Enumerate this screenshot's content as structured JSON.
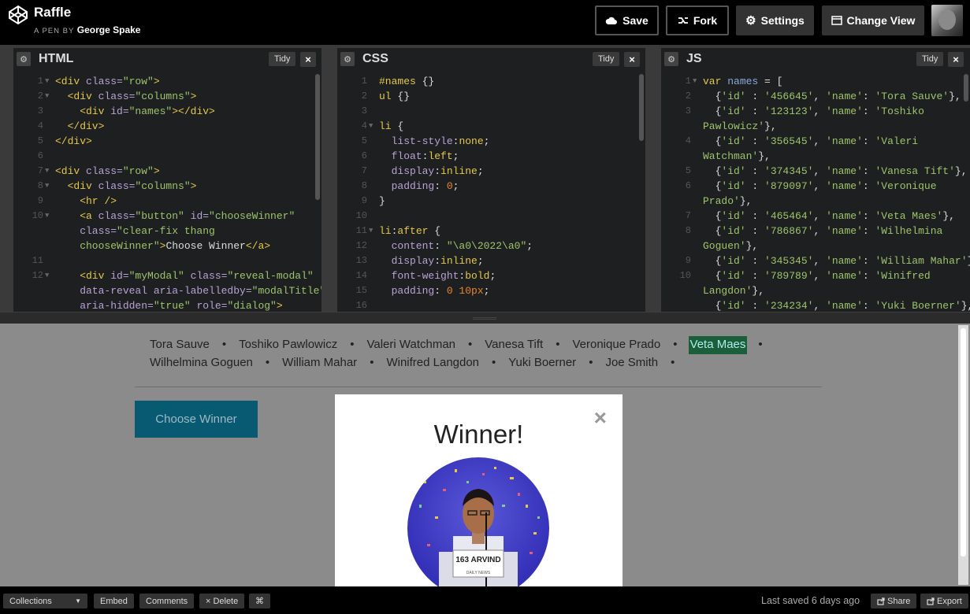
{
  "header": {
    "title": "Raffle",
    "byline_prefix": "A PEN BY",
    "author": "George Spake",
    "buttons": {
      "save": "Save",
      "fork": "Fork",
      "settings": "Settings",
      "change_view": "Change View"
    }
  },
  "editors": {
    "html": {
      "name": "HTML",
      "tidy": "Tidy",
      "close": "×",
      "lines": [
        {
          "n": "1",
          "fold": true,
          "parts": [
            [
              "tag",
              "<div "
            ],
            [
              "attr",
              "class="
            ],
            [
              "str",
              "\"row\""
            ],
            [
              "tag",
              ">"
            ]
          ]
        },
        {
          "n": "2",
          "fold": true,
          "parts": [
            [
              "tag",
              "  <div "
            ],
            [
              "attr",
              "class="
            ],
            [
              "str",
              "\"columns\""
            ],
            [
              "tag",
              ">"
            ]
          ]
        },
        {
          "n": "3",
          "fold": false,
          "parts": [
            [
              "tag",
              "    <div "
            ],
            [
              "attr",
              "id="
            ],
            [
              "str",
              "\"names\""
            ],
            [
              "tag",
              "></div>"
            ]
          ]
        },
        {
          "n": "4",
          "fold": false,
          "parts": [
            [
              "tag",
              "  </div>"
            ]
          ]
        },
        {
          "n": "5",
          "fold": false,
          "parts": [
            [
              "tag",
              "</div>"
            ]
          ]
        },
        {
          "n": "6",
          "fold": false,
          "parts": []
        },
        {
          "n": "7",
          "fold": true,
          "parts": [
            [
              "tag",
              "<div "
            ],
            [
              "attr",
              "class="
            ],
            [
              "str",
              "\"row\""
            ],
            [
              "tag",
              ">"
            ]
          ]
        },
        {
          "n": "8",
          "fold": true,
          "parts": [
            [
              "tag",
              "  <div "
            ],
            [
              "attr",
              "class="
            ],
            [
              "str",
              "\"columns\""
            ],
            [
              "tag",
              ">"
            ]
          ]
        },
        {
          "n": "9",
          "fold": false,
          "parts": [
            [
              "tag",
              "    <hr />"
            ]
          ]
        },
        {
          "n": "10",
          "fold": true,
          "parts": [
            [
              "tag",
              "    <a "
            ],
            [
              "attr",
              "class="
            ],
            [
              "str",
              "\"button\" "
            ],
            [
              "attr",
              "id="
            ],
            [
              "str",
              "\"chooseWinner\""
            ]
          ]
        },
        {
          "n": "",
          "fold": false,
          "parts": [
            [
              "attr",
              "    class="
            ],
            [
              "str",
              "\"clear-fix thang"
            ]
          ]
        },
        {
          "n": "",
          "fold": false,
          "parts": [
            [
              "str",
              "    chooseWinner\""
            ],
            [
              "tag",
              ">"
            ],
            [
              "plain",
              "Choose Winner"
            ],
            [
              "tag",
              "</a>"
            ]
          ]
        },
        {
          "n": "11",
          "fold": false,
          "parts": []
        },
        {
          "n": "12",
          "fold": true,
          "parts": [
            [
              "tag",
              "    <div "
            ],
            [
              "attr",
              "id="
            ],
            [
              "str",
              "\"myModal\" "
            ],
            [
              "attr",
              "class="
            ],
            [
              "str",
              "\"reveal-modal\""
            ]
          ]
        },
        {
          "n": "",
          "fold": false,
          "parts": [
            [
              "attr",
              "    data-reveal aria-labelledby="
            ],
            [
              "str",
              "\"modalTitle\""
            ]
          ]
        },
        {
          "n": "",
          "fold": false,
          "parts": [
            [
              "attr",
              "    aria-hidden="
            ],
            [
              "str",
              "\"true\" "
            ],
            [
              "attr",
              "role="
            ],
            [
              "str",
              "\"dialog\""
            ],
            [
              "tag",
              ">"
            ]
          ]
        }
      ]
    },
    "css": {
      "name": "CSS",
      "tidy": "Tidy",
      "close": "×",
      "lines": [
        {
          "n": "1",
          "fold": false,
          "parts": [
            [
              "sel",
              "#names "
            ],
            [
              "plain",
              "{}"
            ]
          ]
        },
        {
          "n": "2",
          "fold": false,
          "parts": [
            [
              "sel",
              "ul "
            ],
            [
              "plain",
              "{}"
            ]
          ]
        },
        {
          "n": "3",
          "fold": false,
          "parts": []
        },
        {
          "n": "4",
          "fold": true,
          "parts": [
            [
              "sel",
              "li "
            ],
            [
              "plain",
              "{"
            ]
          ]
        },
        {
          "n": "5",
          "fold": false,
          "parts": [
            [
              "prop",
              "  list-style"
            ],
            [
              "plain",
              ":"
            ],
            [
              "kw",
              "none"
            ],
            [
              "plain",
              ";"
            ]
          ]
        },
        {
          "n": "6",
          "fold": false,
          "parts": [
            [
              "prop",
              "  float"
            ],
            [
              "plain",
              ":"
            ],
            [
              "kw",
              "left"
            ],
            [
              "plain",
              ";"
            ]
          ]
        },
        {
          "n": "7",
          "fold": false,
          "parts": [
            [
              "prop",
              "  display"
            ],
            [
              "plain",
              ":"
            ],
            [
              "kw",
              "inline"
            ],
            [
              "plain",
              ";"
            ]
          ]
        },
        {
          "n": "8",
          "fold": false,
          "parts": [
            [
              "prop",
              "  padding"
            ],
            [
              "plain",
              ": "
            ],
            [
              "num",
              "0"
            ],
            [
              "plain",
              ";"
            ]
          ]
        },
        {
          "n": "9",
          "fold": false,
          "parts": [
            [
              "plain",
              "}"
            ]
          ]
        },
        {
          "n": "10",
          "fold": false,
          "parts": []
        },
        {
          "n": "11",
          "fold": true,
          "parts": [
            [
              "sel",
              "li"
            ],
            [
              "plain",
              ":"
            ],
            [
              "sel",
              "after "
            ],
            [
              "plain",
              "{"
            ]
          ]
        },
        {
          "n": "12",
          "fold": false,
          "parts": [
            [
              "prop",
              "  content"
            ],
            [
              "plain",
              ": "
            ],
            [
              "str",
              "\"\\a0\\2022\\a0\""
            ],
            [
              "plain",
              ";"
            ]
          ]
        },
        {
          "n": "13",
          "fold": false,
          "parts": [
            [
              "prop",
              "  display"
            ],
            [
              "plain",
              ":"
            ],
            [
              "kw",
              "inline"
            ],
            [
              "plain",
              ";"
            ]
          ]
        },
        {
          "n": "14",
          "fold": false,
          "parts": [
            [
              "prop",
              "  font-weight"
            ],
            [
              "plain",
              ":"
            ],
            [
              "kw",
              "bold"
            ],
            [
              "plain",
              ";"
            ]
          ]
        },
        {
          "n": "15",
          "fold": false,
          "parts": [
            [
              "prop",
              "  padding"
            ],
            [
              "plain",
              ": "
            ],
            [
              "num",
              "0 10px"
            ],
            [
              "plain",
              ";"
            ]
          ]
        },
        {
          "n": "16",
          "fold": false,
          "parts": []
        }
      ]
    },
    "js": {
      "name": "JS",
      "tidy": "Tidy",
      "close": "×",
      "lines": [
        {
          "n": "1",
          "fold": true,
          "parts": [
            [
              "kw",
              "var "
            ],
            [
              "var",
              "names"
            ],
            [
              "plain",
              " = ["
            ]
          ]
        },
        {
          "n": "2",
          "fold": false,
          "parts": [
            [
              "plain",
              "  {"
            ],
            [
              "str",
              "'id'"
            ],
            [
              "plain",
              " : "
            ],
            [
              "str",
              "'456645'"
            ],
            [
              "plain",
              ", "
            ],
            [
              "str",
              "'name'"
            ],
            [
              "plain",
              ": "
            ],
            [
              "str",
              "'Tora Sauve'"
            ],
            [
              "plain",
              "},"
            ]
          ]
        },
        {
          "n": "3",
          "fold": false,
          "parts": [
            [
              "plain",
              "  {"
            ],
            [
              "str",
              "'id'"
            ],
            [
              "plain",
              " : "
            ],
            [
              "str",
              "'123123'"
            ],
            [
              "plain",
              ", "
            ],
            [
              "str",
              "'name'"
            ],
            [
              "plain",
              ": "
            ],
            [
              "str",
              "'Toshiko"
            ]
          ]
        },
        {
          "n": "",
          "fold": false,
          "parts": [
            [
              "str",
              "Pawlowicz'"
            ],
            [
              "plain",
              "},"
            ]
          ]
        },
        {
          "n": "4",
          "fold": false,
          "parts": [
            [
              "plain",
              "  {"
            ],
            [
              "str",
              "'id'"
            ],
            [
              "plain",
              " : "
            ],
            [
              "str",
              "'356545'"
            ],
            [
              "plain",
              ", "
            ],
            [
              "str",
              "'name'"
            ],
            [
              "plain",
              ": "
            ],
            [
              "str",
              "'Valeri"
            ]
          ]
        },
        {
          "n": "",
          "fold": false,
          "parts": [
            [
              "str",
              "Watchman'"
            ],
            [
              "plain",
              "},"
            ]
          ]
        },
        {
          "n": "5",
          "fold": false,
          "parts": [
            [
              "plain",
              "  {"
            ],
            [
              "str",
              "'id'"
            ],
            [
              "plain",
              " : "
            ],
            [
              "str",
              "'374345'"
            ],
            [
              "plain",
              ", "
            ],
            [
              "str",
              "'name'"
            ],
            [
              "plain",
              ": "
            ],
            [
              "str",
              "'Vanesa Tift'"
            ],
            [
              "plain",
              "},"
            ]
          ]
        },
        {
          "n": "6",
          "fold": false,
          "parts": [
            [
              "plain",
              "  {"
            ],
            [
              "str",
              "'id'"
            ],
            [
              "plain",
              " : "
            ],
            [
              "str",
              "'879097'"
            ],
            [
              "plain",
              ", "
            ],
            [
              "str",
              "'name'"
            ],
            [
              "plain",
              ": "
            ],
            [
              "str",
              "'Veronique"
            ]
          ]
        },
        {
          "n": "",
          "fold": false,
          "parts": [
            [
              "str",
              "Prado'"
            ],
            [
              "plain",
              "},"
            ]
          ]
        },
        {
          "n": "7",
          "fold": false,
          "parts": [
            [
              "plain",
              "  {"
            ],
            [
              "str",
              "'id'"
            ],
            [
              "plain",
              " : "
            ],
            [
              "str",
              "'465464'"
            ],
            [
              "plain",
              ", "
            ],
            [
              "str",
              "'name'"
            ],
            [
              "plain",
              ": "
            ],
            [
              "str",
              "'Veta Maes'"
            ],
            [
              "plain",
              "},"
            ]
          ]
        },
        {
          "n": "8",
          "fold": false,
          "parts": [
            [
              "plain",
              "  {"
            ],
            [
              "str",
              "'id'"
            ],
            [
              "plain",
              " : "
            ],
            [
              "str",
              "'786867'"
            ],
            [
              "plain",
              ", "
            ],
            [
              "str",
              "'name'"
            ],
            [
              "plain",
              ": "
            ],
            [
              "str",
              "'Wilhelmina"
            ]
          ]
        },
        {
          "n": "",
          "fold": false,
          "parts": [
            [
              "str",
              "Goguen'"
            ],
            [
              "plain",
              "},"
            ]
          ]
        },
        {
          "n": "9",
          "fold": false,
          "parts": [
            [
              "plain",
              "  {"
            ],
            [
              "str",
              "'id'"
            ],
            [
              "plain",
              " : "
            ],
            [
              "str",
              "'345345'"
            ],
            [
              "plain",
              ", "
            ],
            [
              "str",
              "'name'"
            ],
            [
              "plain",
              ": "
            ],
            [
              "str",
              "'William Mahar'"
            ],
            [
              "plain",
              "},"
            ]
          ]
        },
        {
          "n": "10",
          "fold": false,
          "parts": [
            [
              "plain",
              "  {"
            ],
            [
              "str",
              "'id'"
            ],
            [
              "plain",
              " : "
            ],
            [
              "str",
              "'789789'"
            ],
            [
              "plain",
              ", "
            ],
            [
              "str",
              "'name'"
            ],
            [
              "plain",
              ": "
            ],
            [
              "str",
              "'Winifred"
            ]
          ]
        },
        {
          "n": "",
          "fold": false,
          "parts": [
            [
              "str",
              "Langdon'"
            ],
            [
              "plain",
              "},"
            ]
          ]
        },
        {
          "n": "",
          "fold": false,
          "parts": [
            [
              "plain",
              "  {"
            ],
            [
              "str",
              "'id'"
            ],
            [
              "plain",
              " : "
            ],
            [
              "str",
              "'234234'"
            ],
            [
              "plain",
              ", "
            ],
            [
              "str",
              "'name'"
            ],
            [
              "plain",
              ": "
            ],
            [
              "str",
              "'Yuki Boerner'"
            ],
            [
              "plain",
              "},"
            ]
          ]
        }
      ]
    }
  },
  "preview": {
    "names": [
      "Tora Sauve",
      "Toshiko Pawlowicz",
      "Valeri Watchman",
      "Vanesa Tift",
      "Veronique Prado",
      "Veta Maes",
      "Wilhelmina Goguen",
      "William Mahar",
      "Winifred Langdon",
      "Yuki Boerner",
      "Joe Smith"
    ],
    "winner_name": "Veta Maes",
    "bullet": "•",
    "choose_button": "Choose Winner",
    "modal": {
      "title": "Winner!",
      "close": "×",
      "photo_caption": "163 ARVIND",
      "photo_caption_sub": "DAILY NEWS"
    }
  },
  "bottombar": {
    "collections": "Collections",
    "embed": "Embed",
    "comments": "Comments",
    "delete": "Delete",
    "shortcut": "⌘",
    "last_saved": "Last saved 6 days ago",
    "share": "Share",
    "export": "Export"
  },
  "colors": {
    "accent_button": "#085a73",
    "winner_highlight": "#1c5d3a"
  }
}
